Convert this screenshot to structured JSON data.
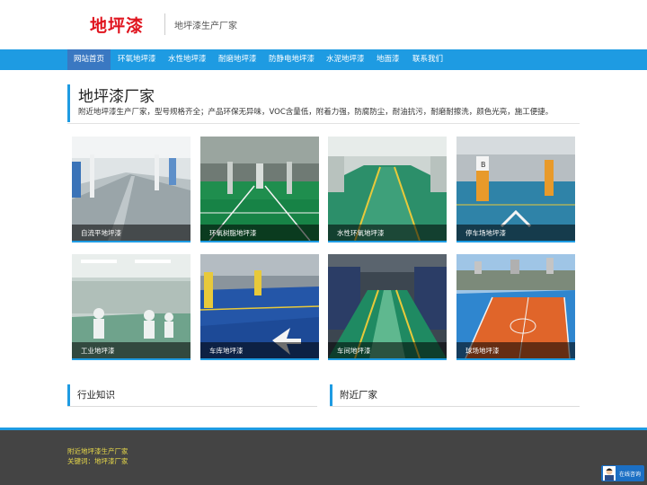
{
  "header": {
    "logo": "地坪漆",
    "tagline": "地坪漆生产厂家"
  },
  "nav": {
    "items": [
      {
        "label": "网站首页",
        "active": true
      },
      {
        "label": "环氧地坪漆",
        "active": false
      },
      {
        "label": "水性地坪漆",
        "active": false
      },
      {
        "label": "耐磨地坪漆",
        "active": false
      },
      {
        "label": "防静电地坪漆",
        "active": false
      },
      {
        "label": "水泥地坪漆",
        "active": false
      },
      {
        "label": "地面漆",
        "active": false
      },
      {
        "label": "联系我们",
        "active": false
      }
    ]
  },
  "main": {
    "title": "地坪漆厂家",
    "description": "附近地坪漆生产厂家，型号规格齐全；产品环保无异味，VOC含量低，附着力强，防腐防尘，耐油抗污，耐磨耐擦洗，颜色光亮，施工便捷。"
  },
  "products": [
    {
      "caption": "自流平地坪漆"
    },
    {
      "caption": "环氧树脂地坪漆"
    },
    {
      "caption": "水性环氧地坪漆"
    },
    {
      "caption": "停车场地坪漆"
    },
    {
      "caption": "工业地坪漆"
    },
    {
      "caption": "车库地坪漆"
    },
    {
      "caption": "车间地坪漆"
    },
    {
      "caption": "球场地坪漆"
    }
  ],
  "sections": {
    "industry": "行业知识",
    "nearby": "附近厂家"
  },
  "footer": {
    "line1": "附近地坪漆生产厂家",
    "line2": "关键词：地坪漆厂家"
  },
  "chat": {
    "label": "在线咨询"
  },
  "colors": {
    "brand_red": "#e0141e",
    "nav_blue": "#1e9be2",
    "nav_active": "#3a78c2",
    "footer_bg": "#444444",
    "footer_text": "#e8d94a"
  }
}
